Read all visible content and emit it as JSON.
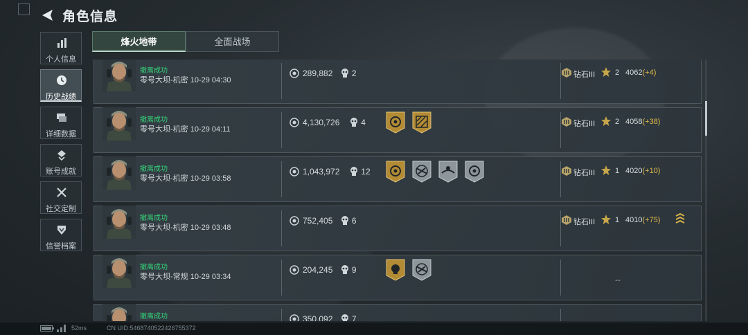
{
  "header": {
    "title": "角色信息"
  },
  "sidebar": {
    "items": [
      {
        "label": "个人信息",
        "icon": "bar-chart-icon",
        "active": false
      },
      {
        "label": "历史战绩",
        "icon": "clock-icon",
        "active": true
      },
      {
        "label": "详细数据",
        "icon": "stack-icon",
        "active": false
      },
      {
        "label": "账号成就",
        "icon": "achievement-icon",
        "active": false
      },
      {
        "label": "社交定制",
        "icon": "tools-icon",
        "active": false
      },
      {
        "label": "信誉档案",
        "icon": "credit-shield-icon",
        "active": false
      }
    ]
  },
  "tabs": [
    {
      "label": "烽火地带",
      "active": true
    },
    {
      "label": "全面战场",
      "active": false
    }
  ],
  "records": [
    {
      "status": "撤离成功",
      "map": "零号大坝-机密",
      "time": "10-29 04:30",
      "value": "289,882",
      "kills": "2",
      "badges": [],
      "rank": "钻石III",
      "stars": "2",
      "score": "4062",
      "delta": "(+4)",
      "streak": false
    },
    {
      "status": "撤离成功",
      "map": "零号大坝-机密",
      "time": "10-29 04:11",
      "value": "4,130,726",
      "kills": "4",
      "badges": [
        "gold-target",
        "gold-stripes"
      ],
      "rank": "钻石III",
      "stars": "2",
      "score": "4058",
      "delta": "(+38)",
      "streak": false
    },
    {
      "status": "撤离成功",
      "map": "零号大坝-机密",
      "time": "10-29 03:58",
      "value": "1,043,972",
      "kills": "12",
      "badges": [
        "gold-target",
        "silver-gun",
        "silver-wave",
        "silver-cross"
      ],
      "rank": "钻石III",
      "stars": "1",
      "score": "4020",
      "delta": "(+10)",
      "streak": false
    },
    {
      "status": "撤离成功",
      "map": "零号大坝-机密",
      "time": "10-29 03:48",
      "value": "752,405",
      "kills": "6",
      "badges": [],
      "rank": "钻石III",
      "stars": "1",
      "score": "4010",
      "delta": "(+75)",
      "streak": true
    },
    {
      "status": "撤离成功",
      "map": "零号大坝-常规",
      "time": "10-29 03:34",
      "value": "204,245",
      "kills": "9",
      "badges": [
        "gold-skull",
        "silver-gun"
      ],
      "rank": "",
      "stars": "",
      "score": "",
      "delta": "",
      "empty": "--",
      "streak": false
    },
    {
      "status": "撤离成功",
      "map": "",
      "time": "",
      "value": "350,092",
      "kills": "7",
      "badges": [],
      "rank": "",
      "stars": "",
      "score": "",
      "delta": "",
      "empty": "--",
      "streak": false
    }
  ],
  "footer": {
    "ping": "52ms",
    "uid": "CN UID:5468740522426755372"
  },
  "colors": {
    "success": "#36d27a",
    "delta": "#e0b84a",
    "gold_badge": "#b38b35",
    "silver_badge": "#8c969b"
  }
}
